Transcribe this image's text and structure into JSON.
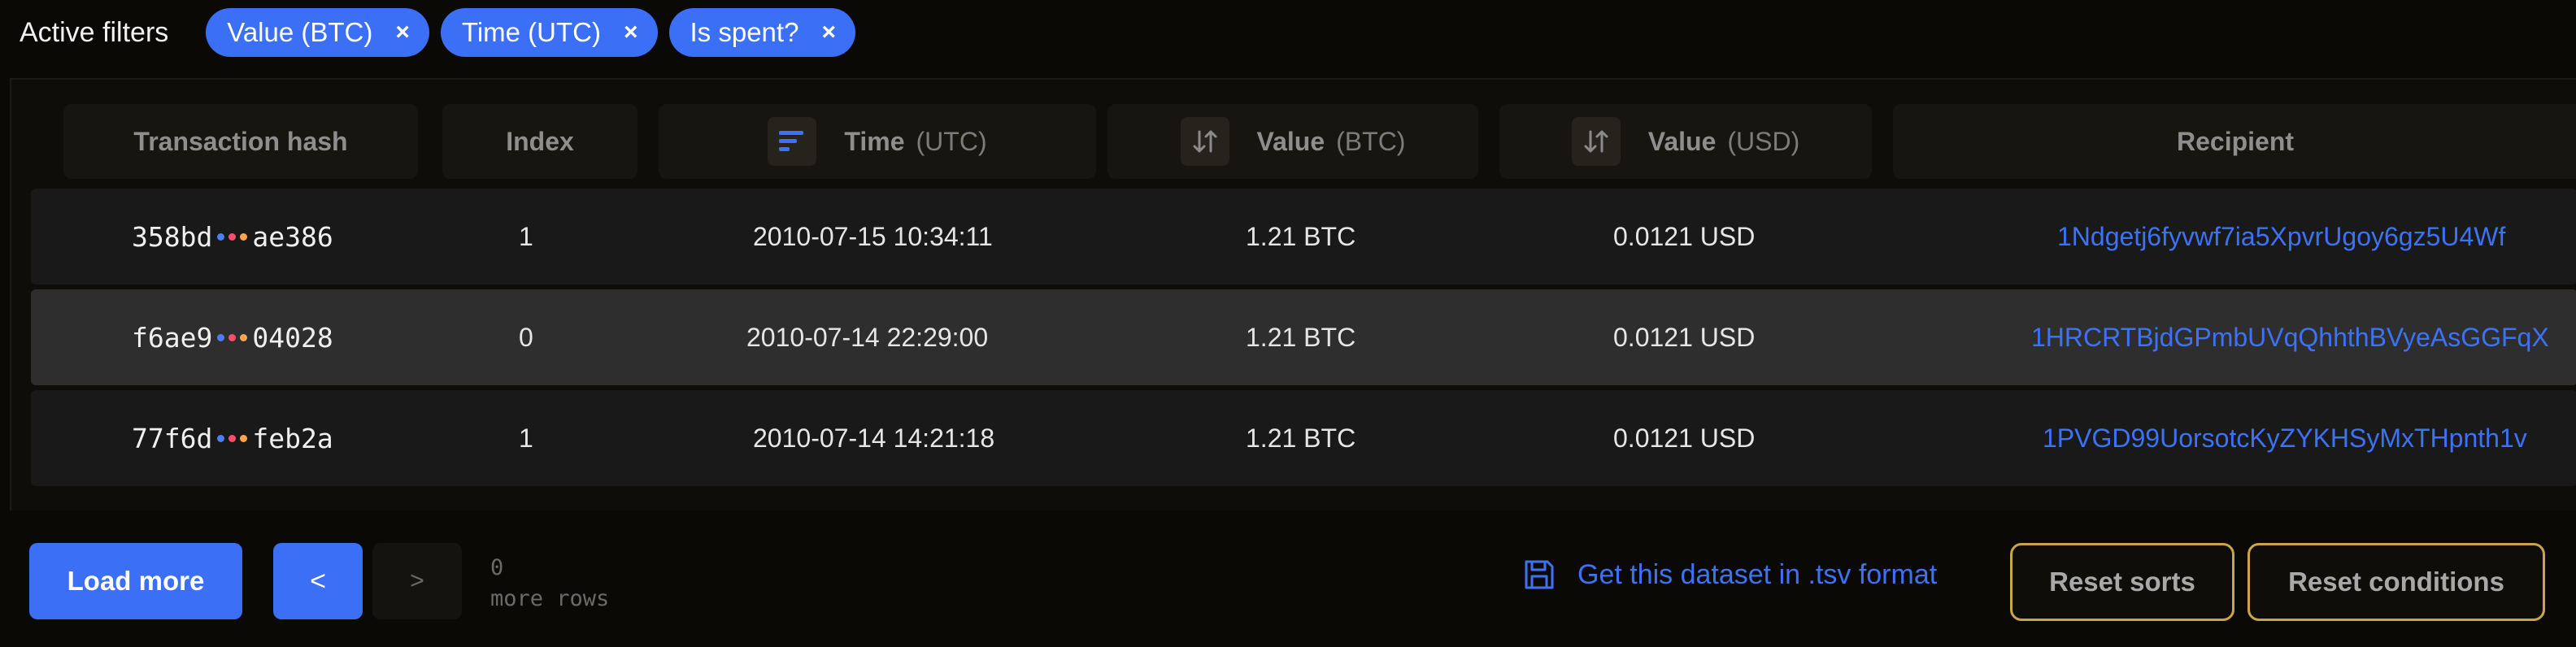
{
  "filters": {
    "label": "Active filters",
    "chips": [
      {
        "label": "Value (BTC)",
        "remove": "×"
      },
      {
        "label": "Time (UTC)",
        "remove": "×"
      },
      {
        "label": "Is spent?",
        "remove": "×"
      }
    ]
  },
  "columns": {
    "hash": {
      "label": "Transaction hash"
    },
    "index": {
      "label": "Index"
    },
    "time": {
      "label": "Time",
      "unit": "(UTC)",
      "sort_icon": "sort-lines-icon"
    },
    "value_btc": {
      "label": "Value",
      "unit": "(BTC)",
      "sort_icon": "sort-arrows-icon"
    },
    "value_usd": {
      "label": "Value",
      "unit": "(USD)",
      "sort_icon": "sort-arrows-icon"
    },
    "recipient": {
      "label": "Recipient"
    }
  },
  "rows": [
    {
      "hash_start": "358bd",
      "hash_end": "ae386",
      "index": "1",
      "time": "2010-07-15 10:34:11",
      "value_btc": "1.21 BTC",
      "value_usd": "0.0121 USD",
      "recipient": "1Ndgetj6fyvwf7ia5XpvrUgoy6gz5U4Wf"
    },
    {
      "hash_start": "f6ae9",
      "hash_end": "04028",
      "index": "0",
      "time": "2010-07-14 22:29:00",
      "value_btc": "1.21 BTC",
      "value_usd": "0.0121 USD",
      "recipient": "1HRCRTBjdGPmbUVqQhhthBVyeAsGGFqX"
    },
    {
      "hash_start": "77f6d",
      "hash_end": "feb2a",
      "index": "1",
      "time": "2010-07-14 14:21:18",
      "value_btc": "1.21 BTC",
      "value_usd": "0.0121 USD",
      "recipient": "1PVGD99UorsotcKyZYKHSyMxTHpnth1v"
    }
  ],
  "footer": {
    "load_more": "Load more",
    "prev": "<",
    "next": ">",
    "more_rows_count": "0",
    "more_rows_label": "more rows",
    "tsv_link": "Get this dataset in .tsv format",
    "reset_sorts": "Reset sorts",
    "reset_conditions": "Reset conditions"
  },
  "colors": {
    "accent": "#3b6ff5",
    "dot_colors": [
      "#4f7cf7",
      "#ff4d6d",
      "#ffa64d"
    ],
    "outline": "#c9a54a"
  }
}
